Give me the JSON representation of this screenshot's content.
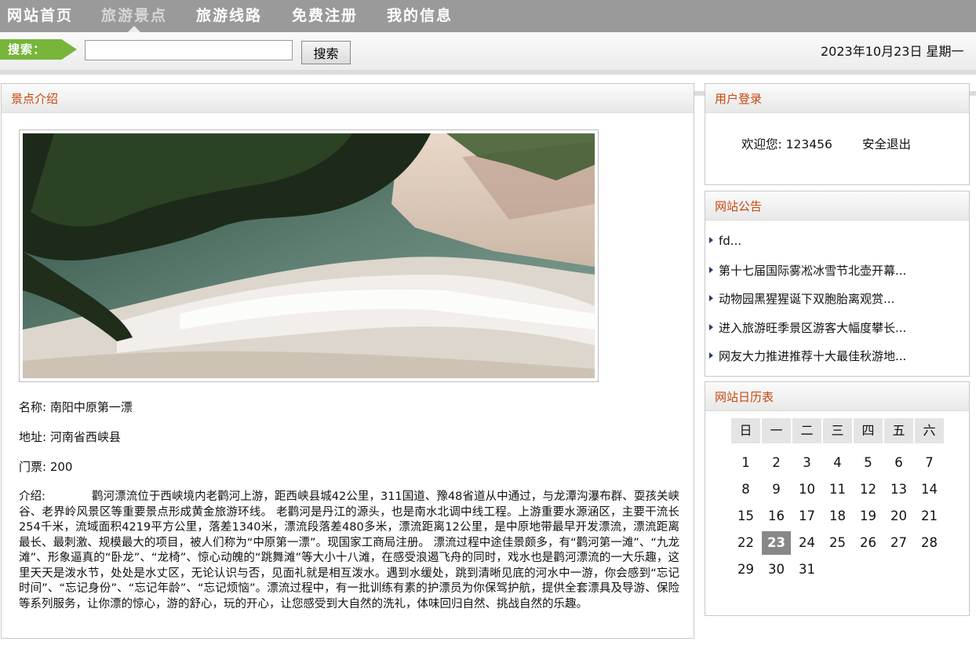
{
  "nav": {
    "items": [
      {
        "label": "网站首页"
      },
      {
        "label": "旅游景点"
      },
      {
        "label": "旅游线路"
      },
      {
        "label": "免费注册"
      },
      {
        "label": "我的信息"
      }
    ],
    "active_index": 1
  },
  "search": {
    "tag_label": "搜索：",
    "input_value": "",
    "button_label": "搜索"
  },
  "date_text": "2023年10月23日 星期一",
  "attraction": {
    "panel_title": "景点介绍",
    "name_label": "名称:",
    "name_value": "南阳中原第一漂",
    "address_label": "地址:",
    "address_value": "河南省西峡县",
    "ticket_label": "门票:",
    "ticket_value": "200",
    "intro_label": "介绍:",
    "intro_text": "鹳河漂流位于西峡境内老鹳河上游，距西峡县城42公里，311国道、豫48省道从中通过，与龙潭沟瀑布群、耍孩关峡谷、老界岭风景区等重要景点形成黄金旅游环线。 老鹳河是丹江的源头，也是南水北调中线工程。上游重要水源涵区，主要干流长254千米，流域面积4219平方公里，落差1340米，漂流段落差480多米，漂流距离12公里，是中原地带最早开发漂流，漂流距离最长、最刺激、规模最大的项目，被人们称为“中原第一漂”。现国家工商局注册。 漂流过程中途佳景颇多，有“鹳河第一滩”、“九龙滩”、形象逼真的“卧龙”、“龙椅”、惊心动魄的“跳舞滩”等大小十八滩，在感受浪遏飞舟的同时，戏水也是鹳河漂流的一大乐趣，这里天天是泼水节，处处是水丈区，无论认识与否，见面礼就是相互泼水。遇到水缓处，跳到清晰见底的河水中一游，你会感到“忘记时间”、“忘记身份”、“忘记年龄”、“忘记烦恼”。漂流过程中，有一批训练有素的护漂员为你保驾护航，提供全套漂具及导游、保险等系列服务，让你漂的惊心，游的舒心，玩的开心，让您感受到大自然的洗礼，体味回归自然、挑战自然的乐趣。"
  },
  "login": {
    "panel_title": "用户登录",
    "welcome_text": "欢迎您:  123456",
    "logout_label": "安全退出"
  },
  "notices": {
    "panel_title": "网站公告",
    "items": [
      {
        "text": "fd..."
      },
      {
        "text": "第十七届国际雾凇冰雪节北壶开幕..."
      },
      {
        "text": "动物园黑猩猩诞下双胞胎离观赏..."
      },
      {
        "text": "进入旅游旺季景区游客大幅度攀长..."
      },
      {
        "text": "网友大力推进推荐十大最佳秋游地..."
      }
    ]
  },
  "calendar": {
    "panel_title": "网站日历表",
    "weekdays": [
      "日",
      "一",
      "二",
      "三",
      "四",
      "五",
      "六"
    ],
    "first_weekday": 0,
    "days_in_month": 31,
    "today": 23
  }
}
